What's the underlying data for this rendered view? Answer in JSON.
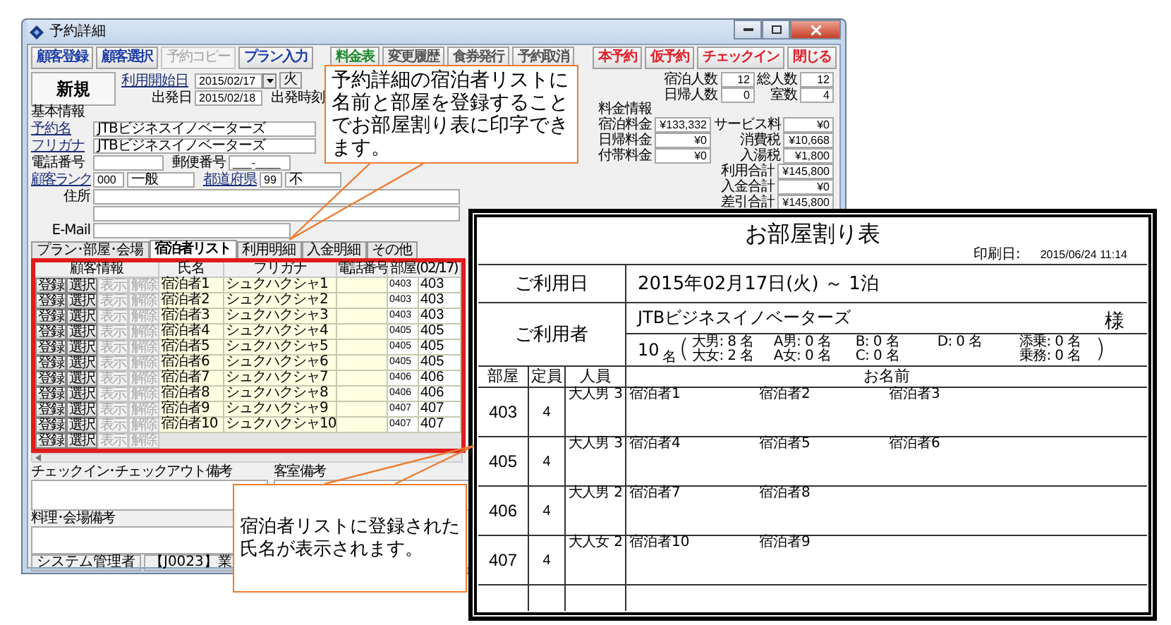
{
  "window": {
    "title": "予約詳細"
  },
  "toolbar": {
    "left": [
      {
        "label": "顧客登録",
        "color": "#1f3fa8",
        "disabled": false
      },
      {
        "label": "顧客選択",
        "color": "#1f3fa8",
        "disabled": false
      },
      {
        "label": "予約コピー",
        "color": "#a0a0a0",
        "disabled": true
      },
      {
        "label": "プラン入力",
        "color": "#1f3fa8",
        "disabled": false
      }
    ],
    "middle": [
      {
        "label": "料金表",
        "color": "#1d8a2a",
        "disabled": false
      },
      {
        "label": "変更履歴",
        "color": "#555555",
        "disabled": false
      },
      {
        "label": "食券発行",
        "color": "#555555",
        "disabled": false
      },
      {
        "label": "予約取消",
        "color": "#555555",
        "disabled": false
      }
    ],
    "right": [
      {
        "label": "本予約",
        "color": "#e0202a",
        "disabled": false
      },
      {
        "label": "仮予約",
        "color": "#e0202a",
        "disabled": false
      },
      {
        "label": "チェックイン",
        "color": "#e0202a",
        "disabled": false
      },
      {
        "label": "閉じる",
        "color": "#e0202a",
        "disabled": false
      }
    ]
  },
  "form": {
    "status": "新規",
    "start_label": "利用開始日",
    "start_date": "2015/02/17",
    "weekday": "火",
    "end_label": "出発日",
    "end_date": "2015/02/18",
    "time_label": "出発時刻",
    "section": "基本情報",
    "name_label": "予約名",
    "name": "JTBビジネスイノベーターズ",
    "kana_label": "フリガナ",
    "kana": "JTBビジネスイノベーターズ",
    "phone_label": "電話番号",
    "rank_label": "顧客ランク",
    "rank_code": "000",
    "rank": "一般",
    "zip_label": "郵便番号",
    "zip": "___-____",
    "pref_label": "都道府県",
    "pref_code": "99",
    "pref": "不",
    "address_label": "住所",
    "email_label": "E-Mail"
  },
  "summary": {
    "counts": [
      {
        "label": "宿泊人数",
        "value": "12"
      },
      {
        "label": "総人数",
        "value": "12"
      },
      {
        "label": "日帰人数",
        "value": "0"
      },
      {
        "label": "室数",
        "value": "4"
      }
    ],
    "fee_title": "料金情報",
    "fees": [
      {
        "label": "宿泊料金",
        "value": "¥133,332"
      },
      {
        "label": "サービス料",
        "value": "¥0"
      },
      {
        "label": "日帰料金",
        "value": "¥0"
      },
      {
        "label": "消費税",
        "value": "¥10,668"
      },
      {
        "label": "付帯料金",
        "value": "¥0"
      },
      {
        "label": "入湯税",
        "value": "¥1,800"
      }
    ],
    "totals": [
      {
        "label": "利用合計",
        "value": "¥145,800"
      },
      {
        "label": "入金合計",
        "value": "¥0"
      },
      {
        "label": "差引合計",
        "value": "¥145,800"
      }
    ]
  },
  "tabs": [
    {
      "label": "プラン･部屋･会場",
      "selected": false
    },
    {
      "label": "宿泊者リスト",
      "selected": true
    },
    {
      "label": "利用明細",
      "selected": false
    },
    {
      "label": "入金明細",
      "selected": false
    },
    {
      "label": "その他",
      "selected": false
    }
  ],
  "guest_list": {
    "columns": [
      "顧客情報",
      "氏名",
      "フリガナ",
      "電話番号",
      "部屋(02/17)"
    ],
    "rows": [
      {
        "buttons": [
          {
            "label": "登録",
            "disabled": false
          },
          {
            "label": "選択",
            "disabled": false
          },
          {
            "label": "表示",
            "disabled": true
          },
          {
            "label": "解除",
            "disabled": true
          }
        ],
        "name": "宿泊者1",
        "kana": "シュクハクシャ1",
        "room_code": "0403",
        "room": "403"
      },
      {
        "buttons": [
          {
            "label": "登録",
            "disabled": false
          },
          {
            "label": "選択",
            "disabled": false
          },
          {
            "label": "表示",
            "disabled": true
          },
          {
            "label": "解除",
            "disabled": true
          }
        ],
        "name": "宿泊者2",
        "kana": "シュクハクシャ2",
        "room_code": "0403",
        "room": "403"
      },
      {
        "buttons": [
          {
            "label": "登録",
            "disabled": false
          },
          {
            "label": "選択",
            "disabled": false
          },
          {
            "label": "表示",
            "disabled": true
          },
          {
            "label": "解除",
            "disabled": true
          }
        ],
        "name": "宿泊者3",
        "kana": "シュクハクシャ3",
        "room_code": "0403",
        "room": "403"
      },
      {
        "buttons": [
          {
            "label": "登録",
            "disabled": false
          },
          {
            "label": "選択",
            "disabled": false
          },
          {
            "label": "表示",
            "disabled": true
          },
          {
            "label": "解除",
            "disabled": true
          }
        ],
        "name": "宿泊者4",
        "kana": "シュクハクシャ4",
        "room_code": "0405",
        "room": "405"
      },
      {
        "buttons": [
          {
            "label": "登録",
            "disabled": false
          },
          {
            "label": "選択",
            "disabled": false
          },
          {
            "label": "表示",
            "disabled": true
          },
          {
            "label": "解除",
            "disabled": true
          }
        ],
        "name": "宿泊者5",
        "kana": "シュクハクシャ5",
        "room_code": "0405",
        "room": "405"
      },
      {
        "buttons": [
          {
            "label": "登録",
            "disabled": false
          },
          {
            "label": "選択",
            "disabled": false
          },
          {
            "label": "表示",
            "disabled": true
          },
          {
            "label": "解除",
            "disabled": true
          }
        ],
        "name": "宿泊者6",
        "kana": "シュクハクシャ6",
        "room_code": "0405",
        "room": "405"
      },
      {
        "buttons": [
          {
            "label": "登録",
            "disabled": false
          },
          {
            "label": "選択",
            "disabled": false
          },
          {
            "label": "表示",
            "disabled": true
          },
          {
            "label": "解除",
            "disabled": true
          }
        ],
        "name": "宿泊者7",
        "kana": "シュクハクシャ7",
        "room_code": "0406",
        "room": "406"
      },
      {
        "buttons": [
          {
            "label": "登録",
            "disabled": false
          },
          {
            "label": "選択",
            "disabled": false
          },
          {
            "label": "表示",
            "disabled": true
          },
          {
            "label": "解除",
            "disabled": true
          }
        ],
        "name": "宿泊者8",
        "kana": "シュクハクシャ8",
        "room_code": "0406",
        "room": "406"
      },
      {
        "buttons": [
          {
            "label": "登録",
            "disabled": false
          },
          {
            "label": "選択",
            "disabled": false
          },
          {
            "label": "表示",
            "disabled": true
          },
          {
            "label": "解除",
            "disabled": true
          }
        ],
        "name": "宿泊者9",
        "kana": "シュクハクシャ9",
        "room_code": "0407",
        "room": "407"
      },
      {
        "buttons": [
          {
            "label": "登録",
            "disabled": false
          },
          {
            "label": "選択",
            "disabled": false
          },
          {
            "label": "表示",
            "disabled": true
          },
          {
            "label": "解除",
            "disabled": true
          }
        ],
        "name": "宿泊者10",
        "kana": "シュクハクシャ10",
        "room_code": "0407",
        "room": "407"
      }
    ],
    "new_row_buttons": [
      {
        "label": "登録",
        "disabled": false
      },
      {
        "label": "選択",
        "disabled": false
      },
      {
        "label": "表示",
        "disabled": true
      },
      {
        "label": "解除",
        "disabled": true
      }
    ]
  },
  "remarks": [
    {
      "label": "チェックイン･チェックアウト備考"
    },
    {
      "label": "客室備考"
    },
    {
      "label": "料理･会場備考"
    }
  ],
  "status_bar": [
    "システム管理者",
    "【J0023】業"
  ],
  "callouts": [
    {
      "text": "予約詳細の宿泊者リストに名前と部屋を登録することでお部屋割り表に印字できます。"
    },
    {
      "text": "宿泊者リストに登録された氏名が表示されます。"
    }
  ],
  "document": {
    "title": "お部屋割り表",
    "print_label": "印刷日:",
    "print_date": "2015/06/24 11:14",
    "usage_label": "ご利用日",
    "usage": "2015年02月17日(火) ～ 1泊",
    "customer_label": "ご利用者",
    "customer": "JTBビジネスイノベーターズ",
    "honorific": "様",
    "total": "10",
    "total_unit": "名",
    "open_paren": "(",
    "close_paren": ")",
    "counts": [
      {
        "top": {
          "label": "大男:",
          "value": "8",
          "unit": "名"
        },
        "bottom": {
          "label": "大女:",
          "value": "2",
          "unit": "名"
        }
      },
      {
        "top": {
          "label": "A男:",
          "value": "0",
          "unit": "名"
        },
        "bottom": {
          "label": "A女:",
          "value": "0",
          "unit": "名"
        }
      },
      {
        "top": {
          "label": "B:",
          "value": "0",
          "unit": "名"
        },
        "bottom": {
          "label": "C:",
          "value": "0",
          "unit": "名"
        }
      },
      {
        "top": {
          "label": "D:",
          "value": "0",
          "unit": "名"
        }
      },
      {
        "top": {
          "label": "添乗:",
          "value": "0",
          "unit": "名"
        },
        "bottom": {
          "label": "乗務:",
          "value": "0",
          "unit": "名"
        }
      }
    ],
    "columns": [
      "部屋",
      "定員",
      "人員",
      "お名前"
    ],
    "rooms": [
      {
        "room": "403",
        "capacity": "4",
        "party": "大人男",
        "party_count": "3",
        "guests": [
          "宿泊者1",
          "宿泊者2",
          "宿泊者3"
        ]
      },
      {
        "room": "405",
        "capacity": "4",
        "party": "大人男",
        "party_count": "3",
        "guests": [
          "宿泊者4",
          "宿泊者5",
          "宿泊者6"
        ]
      },
      {
        "room": "406",
        "capacity": "4",
        "party": "大人男",
        "party_count": "2",
        "guests": [
          "宿泊者7",
          "宿泊者8"
        ]
      },
      {
        "room": "407",
        "capacity": "4",
        "party": "大人女",
        "party_count": "2",
        "guests": [
          "宿泊者10",
          "宿泊者9"
        ]
      }
    ]
  }
}
